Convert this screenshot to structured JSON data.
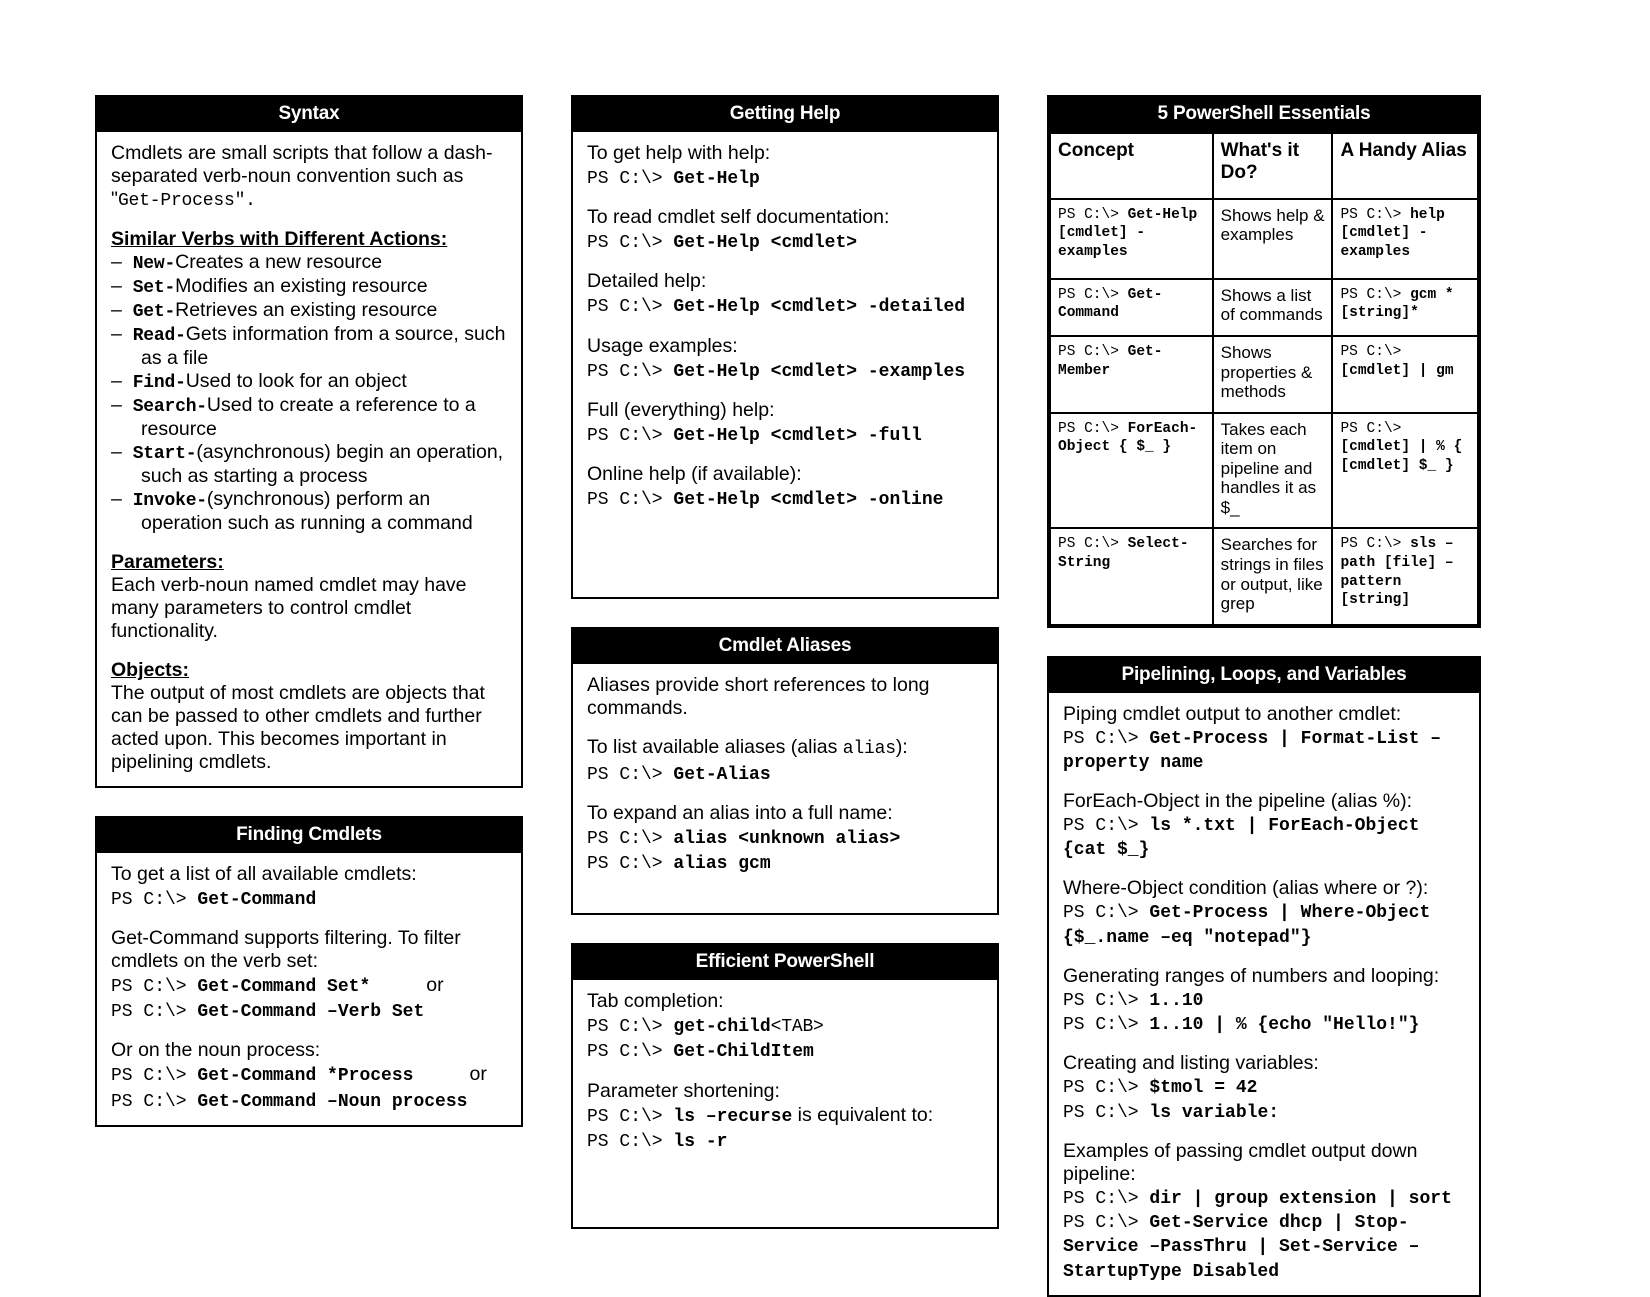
{
  "document": {
    "type": "PowerShell cheat sheet",
    "columns": 3
  },
  "panels": {
    "syntax": {
      "title": "Syntax",
      "intro_1": "Cmdlets are small scripts that follow a dash-separated verb-noun convention such as \"",
      "intro_code": "Get-Process",
      "intro_2": "\".",
      "verbs_heading": "Similar Verbs with Different Actions:",
      "verbs": [
        {
          "verb": "New-",
          "desc": "Creates a new resource"
        },
        {
          "verb": "Set-",
          "desc": "Modifies an existing resource"
        },
        {
          "verb": "Get-",
          "desc": "Retrieves an existing resource"
        },
        {
          "verb": "Read-",
          "desc": "Gets information from a source, such as a file"
        },
        {
          "verb": "Find-",
          "desc": "Used to look for an object"
        },
        {
          "verb": "Search-",
          "desc": "Used to create a reference to a resource"
        },
        {
          "verb": "Start-",
          "desc": "(asynchronous) begin an operation, such as starting a process"
        },
        {
          "verb": "Invoke-",
          "desc": "(synchronous) perform an operation such as running a command"
        }
      ],
      "parameters_heading": "Parameters:",
      "parameters_body": "Each verb-noun named cmdlet may have many parameters to control cmdlet functionality.",
      "objects_heading": "Objects:",
      "objects_body": "The output of most cmdlets are objects that can be passed to other cmdlets and further acted upon.  This becomes important in pipelining cmdlets."
    },
    "finding_cmdlets": {
      "title": "Finding Cmdlets",
      "blocks": [
        {
          "label": "To get a list of all available cmdlets:",
          "lines": [
            {
              "prompt": "PS C:\\> ",
              "cmd": "Get-Command",
              "suffix": ""
            }
          ]
        },
        {
          "label": "Get-Command supports filtering.  To filter cmdlets on the verb set:",
          "lines": [
            {
              "prompt": "PS C:\\> ",
              "cmd": "Get-Command Set*",
              "suffix": "or"
            },
            {
              "prompt": "PS C:\\> ",
              "cmd": "Get-Command –Verb Set",
              "suffix": ""
            }
          ]
        },
        {
          "label": "Or on the noun process:",
          "lines": [
            {
              "prompt": "PS C:\\> ",
              "cmd": "Get-Command *Process",
              "suffix": "or"
            },
            {
              "prompt": "PS C:\\> ",
              "cmd": "Get-Command –Noun process",
              "suffix": ""
            }
          ]
        }
      ]
    },
    "getting_help": {
      "title": "Getting Help",
      "blocks": [
        {
          "label": "To get help with help:",
          "prompt": "PS C:\\> ",
          "cmd": "Get-Help"
        },
        {
          "label": "To read cmdlet self documentation:",
          "prompt": "PS C:\\> ",
          "cmd": "Get-Help <cmdlet>"
        },
        {
          "label": "Detailed help:",
          "prompt": "PS C:\\> ",
          "cmd": "Get-Help <cmdlet> -detailed"
        },
        {
          "label": "Usage examples:",
          "prompt": "PS C:\\> ",
          "cmd": "Get-Help <cmdlet> -examples"
        },
        {
          "label": "Full (everything) help:",
          "prompt": "PS C:\\> ",
          "cmd": "Get-Help <cmdlet> -full"
        },
        {
          "label": "Online help (if available):",
          "prompt": "PS C:\\> ",
          "cmd": "Get-Help <cmdlet> -online"
        }
      ]
    },
    "cmdlet_aliases": {
      "title": "Cmdlet Aliases",
      "intro": "Aliases provide short references to long commands.",
      "list_label_pre": "To list available aliases (alias ",
      "list_label_code": "alias",
      "list_label_post": "):",
      "list_prompt": "PS C:\\> ",
      "list_cmd": "Get-Alias",
      "expand_label": "To expand an alias into a full name:",
      "expand_lines": [
        {
          "prompt": "PS C:\\> ",
          "cmd": "alias <unknown alias>"
        },
        {
          "prompt": "PS C:\\> ",
          "cmd": "alias gcm"
        }
      ]
    },
    "efficient_powershell": {
      "title": "Efficient PowerShell",
      "tab_label": "Tab completion:",
      "tab_lines": [
        {
          "prompt": "PS C:\\> ",
          "cmd": "get-child",
          "plain": "<TAB>"
        },
        {
          "prompt": "PS C:\\> ",
          "cmd": "Get-ChildItem",
          "plain": ""
        }
      ],
      "param_label": "Parameter shortening:",
      "param_lines": [
        {
          "prompt": "PS C:\\> ",
          "cmd": "ls –recurse",
          "suffix": "is equivalent to:"
        },
        {
          "prompt": "PS C:\\> ",
          "cmd": "ls -r",
          "suffix": ""
        }
      ]
    },
    "essentials": {
      "title": "5 PowerShell Essentials",
      "headers": [
        "Concept",
        "What's it Do?",
        "A Handy Alias"
      ],
      "rows": [
        {
          "concept_prompt": "PS C:\\> ",
          "concept_cmd": "Get-Help [cmdlet] -examples",
          "does": "Shows help & examples",
          "alias_prompt": "PS C:\\> ",
          "alias_cmd": "help [cmdlet] -examples"
        },
        {
          "concept_prompt": "PS C:\\> ",
          "concept_cmd": "Get-Command",
          "does": "Shows a list of commands",
          "alias_prompt": "PS C:\\> ",
          "alias_cmd": "gcm *[string]*"
        },
        {
          "concept_prompt": "PS C:\\> ",
          "concept_cmd": "Get-Member",
          "does": "Shows properties & methods",
          "alias_prompt": "PS C:\\> ",
          "alias_cmd": "[cmdlet] | gm"
        },
        {
          "concept_prompt": "PS C:\\> ",
          "concept_cmd": "ForEach-Object { $_ }",
          "does": "Takes each item on pipeline and handles it as $_",
          "alias_prompt": "PS C:\\> ",
          "alias_cmd": "[cmdlet] | % { [cmdlet] $_ }"
        },
        {
          "concept_prompt": "PS C:\\> ",
          "concept_cmd": "Select-String",
          "does": "Searches for strings in files or output, like grep",
          "alias_prompt": "PS C:\\> ",
          "alias_cmd": "sls –path [file] –pattern [string]"
        }
      ]
    },
    "pipelining": {
      "title": "Pipelining, Loops, and Variables",
      "blocks": [
        {
          "label": "Piping cmdlet output to another cmdlet:",
          "lines": [
            {
              "prompt": "PS C:\\> ",
              "cmd": "Get-Process | Format-List –property name"
            }
          ]
        },
        {
          "label": "ForEach-Object in the pipeline (alias %):",
          "label_code": "%",
          "lines": [
            {
              "prompt": "PS C:\\> ",
              "cmd": "ls *.txt | ForEach-Object {cat $_}"
            }
          ]
        },
        {
          "label": "Where-Object condition (alias where or ?):",
          "lines": [
            {
              "prompt": "PS C:\\> ",
              "cmd": "Get-Process | Where-Object {$_.name –eq \"notepad\"}"
            }
          ]
        },
        {
          "label": "Generating ranges of numbers and looping:",
          "lines": [
            {
              "prompt": "PS C:\\> ",
              "cmd": "1..10"
            },
            {
              "prompt": "PS C:\\> ",
              "cmd": "1..10 | % {echo \"Hello!\"}"
            }
          ]
        },
        {
          "label": "Creating and listing variables:",
          "lines": [
            {
              "prompt": "PS C:\\> ",
              "cmd": "$tmol = 42"
            },
            {
              "prompt": "PS C:\\> ",
              "cmd": "ls variable:"
            }
          ]
        },
        {
          "label": "Examples of passing cmdlet output down pipeline:",
          "lines": [
            {
              "prompt": "PS C:\\> ",
              "cmd": "dir | group extension | sort"
            },
            {
              "prompt": "PS C:\\> ",
              "cmd": "Get-Service dhcp | Stop-Service –PassThru | Set-Service –StartupType Disabled"
            }
          ]
        }
      ]
    }
  }
}
